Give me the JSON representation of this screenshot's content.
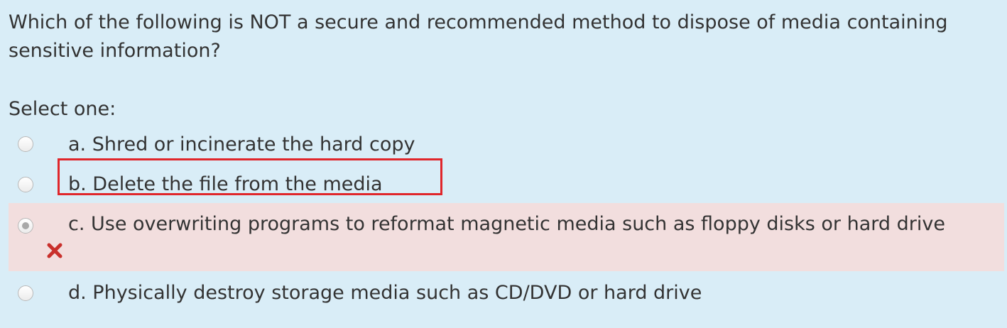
{
  "question": {
    "text": "Which of the following is NOT a secure and recommended method to dispose of media containing sensitive information?",
    "prompt": "Select one:"
  },
  "options": [
    {
      "label": "a. Shred or incinerate the hard copy",
      "selected": false,
      "state": ""
    },
    {
      "label": "b. Delete the file from the media",
      "selected": false,
      "state": "highlighted"
    },
    {
      "label": "c. Use overwriting programs to reformat magnetic media such as floppy disks or hard drive",
      "selected": true,
      "state": "incorrect"
    },
    {
      "label": "d. Physically destroy storage media such as CD/DVD or hard drive",
      "selected": false,
      "state": ""
    }
  ],
  "icons": {
    "incorrect": "cross-icon"
  },
  "colors": {
    "background": "#d9edf7",
    "incorrect_background": "#f2dede",
    "incorrect_icon": "#c9302c",
    "highlight_border": "#e0262b",
    "text": "#333333"
  }
}
